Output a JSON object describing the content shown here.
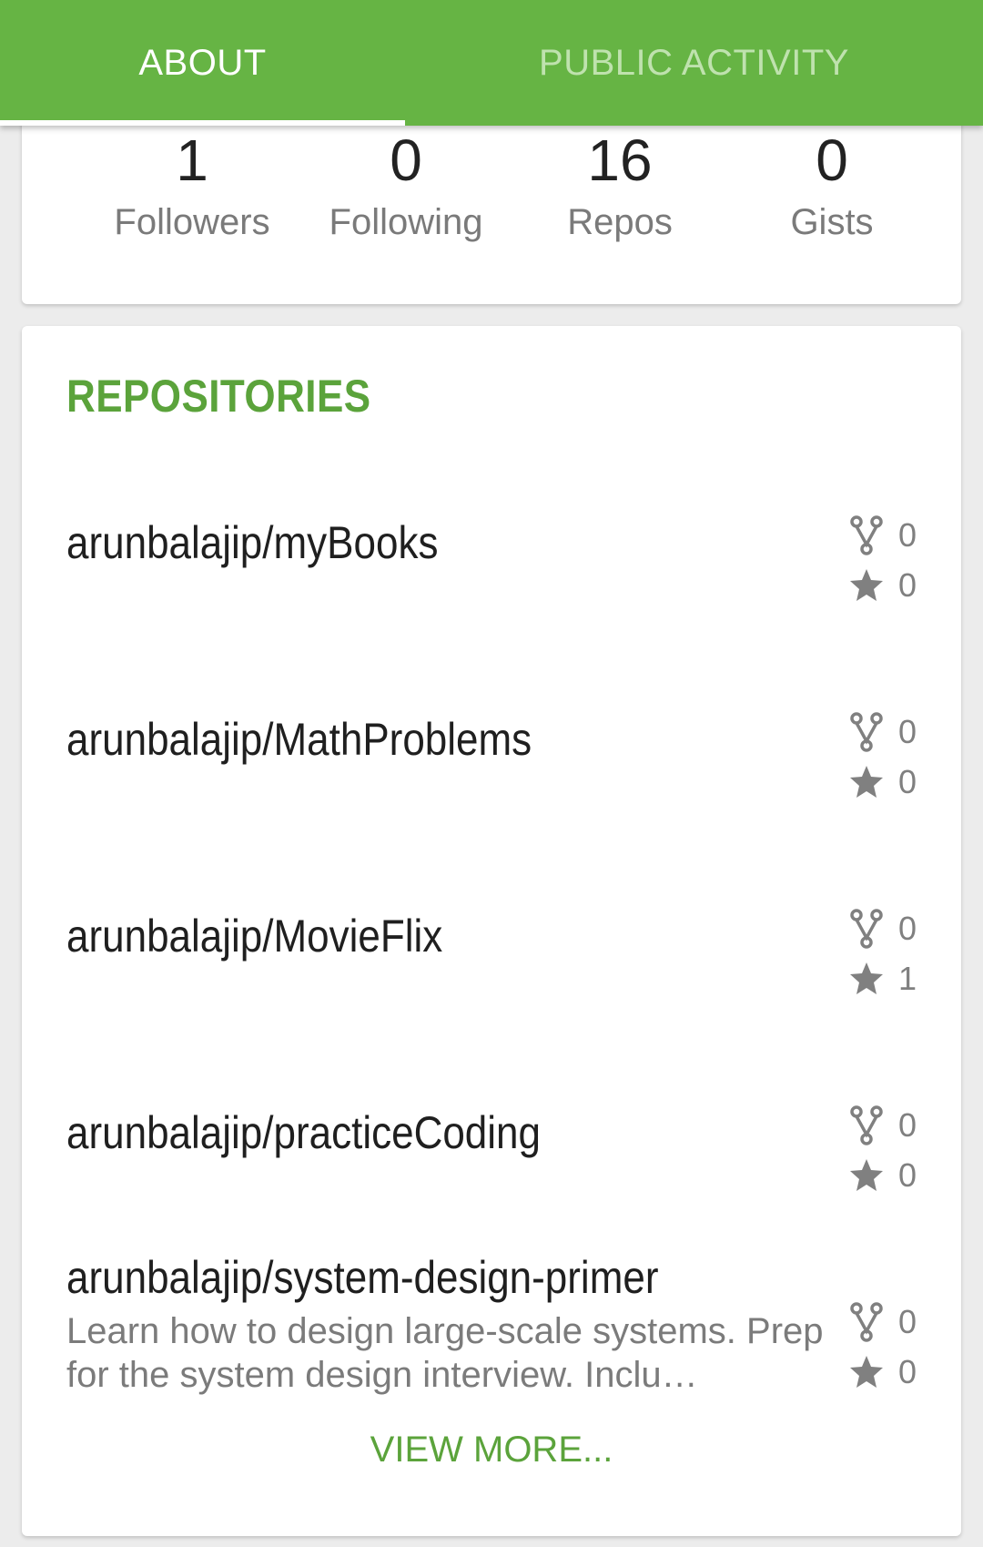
{
  "tabs": {
    "about": "ABOUT",
    "public_activity": "PUBLIC ACTIVITY"
  },
  "stats": {
    "followers": {
      "value": "1",
      "label": "Followers"
    },
    "following": {
      "value": "0",
      "label": "Following"
    },
    "repos": {
      "value": "16",
      "label": "Repos"
    },
    "gists": {
      "value": "0",
      "label": "Gists"
    }
  },
  "repositories": {
    "title": "REPOSITORIES",
    "items": [
      {
        "name": "arunbalajip/myBooks",
        "description": "",
        "forks": "0",
        "stars": "0"
      },
      {
        "name": "arunbalajip/MathProblems",
        "description": "",
        "forks": "0",
        "stars": "0"
      },
      {
        "name": "arunbalajip/MovieFlix",
        "description": "",
        "forks": "0",
        "stars": "1"
      },
      {
        "name": "arunbalajip/practiceCoding",
        "description": "",
        "forks": "0",
        "stars": "0"
      },
      {
        "name": "arunbalajip/system-design-primer",
        "description": "Learn how to design large-scale systems. Prep for the system design interview.  Inclu…",
        "forks": "0",
        "stars": "0"
      }
    ],
    "view_more": "VIEW MORE..."
  },
  "colors": {
    "accent": "#66b444",
    "accent_text": "#5ba33b",
    "icon": "#808080"
  },
  "icons": {
    "fork": "fork-icon",
    "star": "star-icon"
  }
}
